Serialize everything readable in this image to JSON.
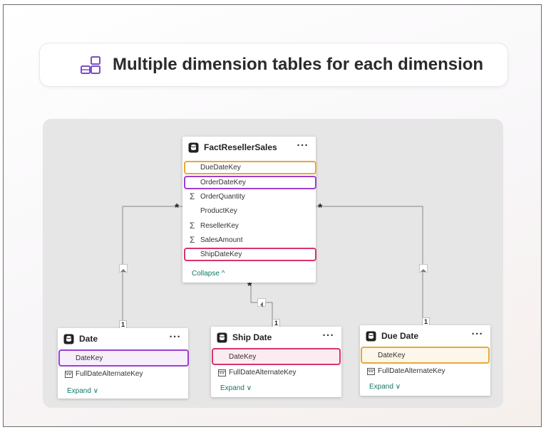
{
  "title": {
    "text": "Multiple dimension tables for each dimension",
    "icon": "relationship-model-icon"
  },
  "colors": {
    "due": "#e8a838",
    "order": "#9b3fd2",
    "ship": "#d8336f",
    "accent": "#117865"
  },
  "fact_table": {
    "name": "FactResellerSales",
    "more": "···",
    "fields": [
      {
        "label": "DueDateKey",
        "icon": ""
      },
      {
        "label": "OrderDateKey",
        "icon": ""
      },
      {
        "label": "OrderQuantity",
        "icon": "Σ"
      },
      {
        "label": "ProductKey",
        "icon": ""
      },
      {
        "label": "ResellerKey",
        "icon": "Σ"
      },
      {
        "label": "SalesAmount",
        "icon": "Σ"
      },
      {
        "label": "ShipDateKey",
        "icon": ""
      }
    ],
    "toggle": "Collapse ^"
  },
  "dim_tables": [
    {
      "name": "Date",
      "more": "···",
      "key": "DateKey",
      "alt": "FullDateAlternateKey",
      "toggle": "Expand ∨"
    },
    {
      "name": "Ship Date",
      "more": "···",
      "key": "DateKey",
      "alt": "FullDateAlternateKey",
      "toggle": "Expand ∨"
    },
    {
      "name": "Due Date",
      "more": "···",
      "key": "DateKey",
      "alt": "FullDateAlternateKey",
      "toggle": "Expand ∨"
    }
  ],
  "relationships": {
    "many": "*",
    "one": "1"
  }
}
